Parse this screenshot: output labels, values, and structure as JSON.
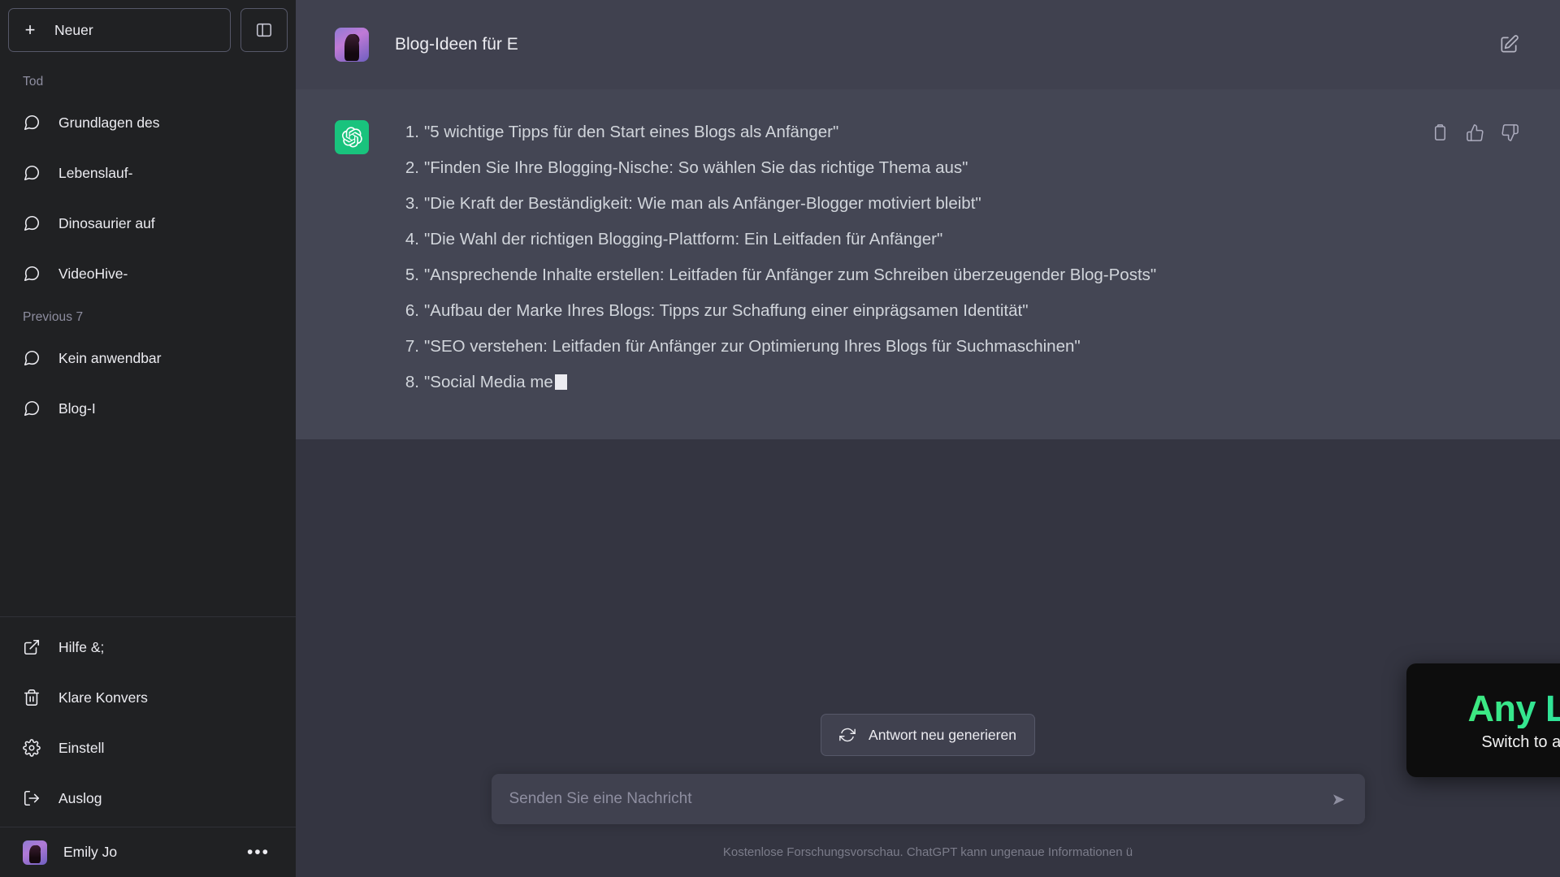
{
  "sidebar": {
    "new_chat_label": "Neuer",
    "plus_icon": "plus-icon",
    "panel_toggle_icon": "sidebar-panel-icon",
    "sections": [
      {
        "label": "Tod",
        "items": [
          {
            "label": "Grundlagen des",
            "icon": "chat-bubble-icon"
          },
          {
            "label": "Lebenslauf-",
            "icon": "chat-bubble-icon"
          },
          {
            "label": "Dinosaurier auf",
            "icon": "chat-bubble-icon"
          },
          {
            "label": "VideoHive-",
            "icon": "chat-bubble-icon"
          }
        ]
      },
      {
        "label": "Previous 7",
        "items": [
          {
            "label": "Kein anwendbar",
            "icon": "chat-bubble-icon"
          },
          {
            "label": "Blog-I",
            "icon": "chat-bubble-icon"
          }
        ]
      }
    ],
    "footer_items": [
      {
        "label": "Hilfe &;",
        "icon": "external-link-icon"
      },
      {
        "label": "Klare Konvers",
        "icon": "trash-icon"
      },
      {
        "label": "Einstell",
        "icon": "gear-icon"
      },
      {
        "label": "Auslog",
        "icon": "logout-icon"
      }
    ],
    "user": {
      "name": "Emily Jo",
      "avatar": "user-avatar",
      "menu_icon": "ellipsis-icon"
    }
  },
  "header": {
    "title": "Blog-Ideen für E",
    "avatar": "conversation-avatar",
    "edit_icon": "edit-square-icon"
  },
  "message": {
    "author_icon": "chatgpt-logo-icon",
    "items": [
      "\"5 wichtige Tipps für den Start eines Blogs als Anfänger\"",
      "\"Finden Sie Ihre Blogging-Nische: So wählen Sie das richtige Thema aus\"",
      "\"Die Kraft der Beständigkeit: Wie man als Anfänger-Blogger motiviert bleibt\"",
      "\"Die Wahl der richtigen Blogging-Plattform: Ein Leitfaden für Anfänger\"",
      "\"Ansprechende Inhalte erstellen: Leitfaden für Anfänger zum Schreiben überzeugender Blog-Posts\"",
      "\"Aufbau der Marke Ihres Blogs: Tipps zur Schaffung einer einprägsamen Identität\"",
      "\"SEO verstehen: Leitfaden für Anfänger zur Optimierung Ihres Blogs für Suchmaschinen\"",
      "\"Social Media me"
    ],
    "actions": [
      {
        "icon": "copy-icon"
      },
      {
        "icon": "thumbs-up-icon"
      },
      {
        "icon": "thumbs-down-icon"
      }
    ]
  },
  "composer": {
    "regenerate_label": "Antwort neu generieren",
    "regenerate_icon": "refresh-icon",
    "input_placeholder": "Senden Sie eine Nachricht",
    "input_value": "",
    "send_icon": "send-arrow-icon",
    "footer_note": "Kostenlose Forschungsvorschau. ChatGPT kann ungenaue Informationen ü"
  },
  "overlay": {
    "title": "Any Language",
    "subtitle": "Switch to any Language easily"
  },
  "colors": {
    "sidebar_bg": "#202123",
    "main_bg": "#343541",
    "message_bg": "#444654",
    "header_bg": "#40414f",
    "accent_green": "#19c37d",
    "overlay_gradient_start": "#3ee97f",
    "overlay_gradient_end": "#3ec8e0"
  }
}
